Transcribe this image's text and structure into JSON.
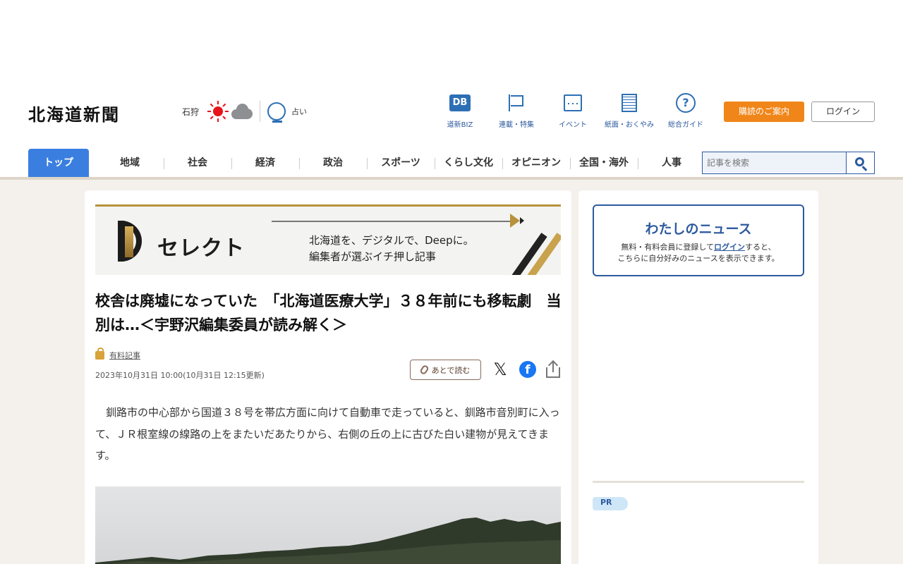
{
  "header": {
    "logo": "北海道新聞",
    "weather_city": "石狩",
    "fortune_label": "占い",
    "nav": [
      {
        "label": "道新BIZ",
        "icon": "db-icon"
      },
      {
        "label": "連載・特集",
        "icon": "flag-icon"
      },
      {
        "label": "イベント",
        "icon": "calendar-icon"
      },
      {
        "label": "紙面・おくやみ",
        "icon": "newspaper-icon"
      },
      {
        "label": "総合ガイド",
        "icon": "help-icon"
      }
    ],
    "db_mark": "DB",
    "subscribe_label": "購読のご案内",
    "login_label": "ログイン"
  },
  "categories": [
    "トップ",
    "地域",
    "社会",
    "経済",
    "政治",
    "スポーツ",
    "くらし文化",
    "オピニオン",
    "全国・海外",
    "人事"
  ],
  "search": {
    "placeholder": "記事を検索"
  },
  "banner": {
    "brand": "セレクト",
    "tagline1": "北海道を、デジタルで、Deepに。",
    "tagline2": "編集者が選ぶイチ押し記事"
  },
  "article": {
    "title": "校舎は廃墟になっていた　「北海道医療大学」３８年前にも移転劇　当別は…＜宇野沢編集委員が読み解く＞",
    "paid_label": "有料記事",
    "date": "2023年10月31日 10:00(10月31日 12:15更新)",
    "read_later_label": "あとで読む",
    "body": "　釧路市の中心部から国道３８号を帯広方面に向けて自動車で走っていると、釧路市音別町に入って、ＪＲ根室線の線路の上をまたいだあたりから、右側の丘の上に古びた白い建物が見えてきます。"
  },
  "sidebar": {
    "mynews_title": "わたしのニュース",
    "mynews_text1": "無料・有料会員に登録して",
    "mynews_login_link": "ログイン",
    "mynews_text2": "すると、",
    "mynews_text3": "こちらに自分好みのニュースを表示できます。",
    "pr_label": "PR"
  },
  "colors": {
    "accent_blue": "#2d5a9e",
    "active_tab": "#3a7ee0",
    "subscribe_orange": "#f08619",
    "page_bg": "#f4f1ec",
    "sun_red": "#e8141b",
    "facebook_blue": "#1877f2"
  }
}
